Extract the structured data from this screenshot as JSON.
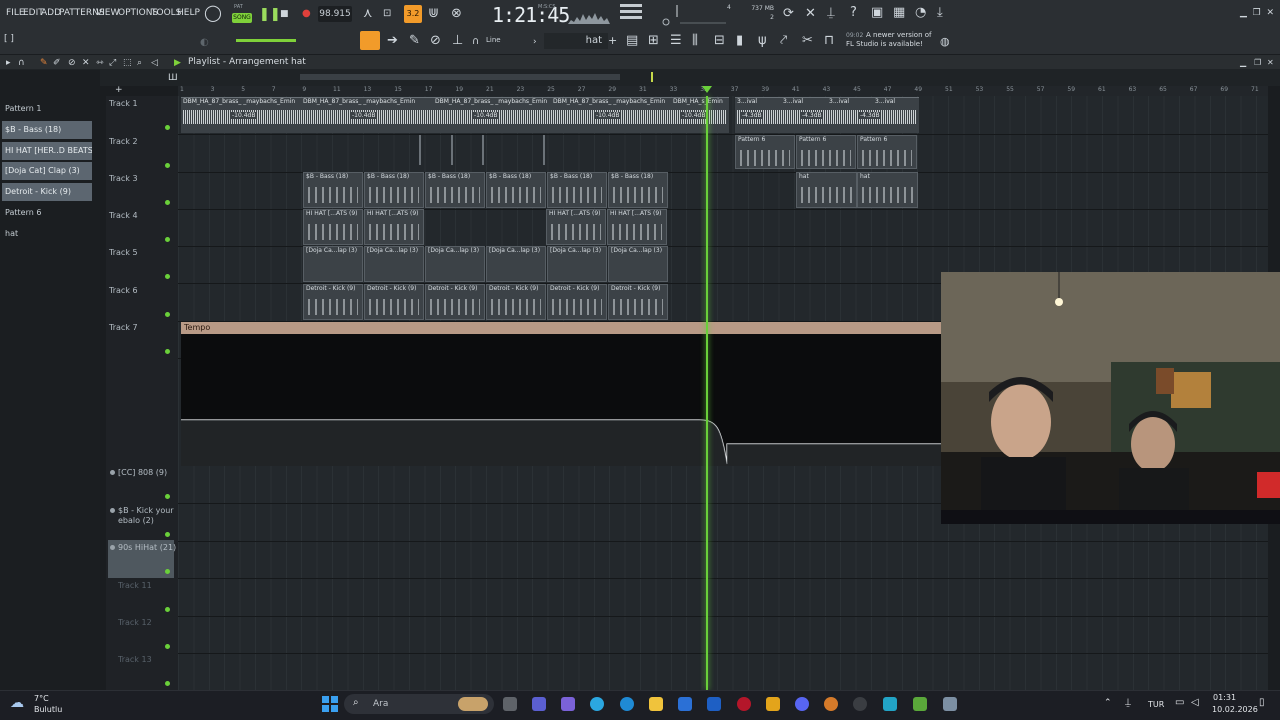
{
  "menu": {
    "file": "FILE",
    "edit": "EDIT",
    "add": "ADD",
    "patterns": "PATTERNS",
    "view": "VIEW",
    "options": "OPTIONS",
    "tools": "TOOLS",
    "help": "HELP"
  },
  "transport": {
    "pat_label": "PAT",
    "song_label": "SONG",
    "tempo": "98.915",
    "time": "1:21:45",
    "time_unit": "M:S:CS",
    "snap": "3.2",
    "memory": "737 MB",
    "cpu": "2",
    "voices": "4"
  },
  "toolbar2": {
    "line_label": "Line",
    "pattern_name": "hat",
    "update_time": "09:02",
    "update_msg": "A newer version of FL Studio is available!"
  },
  "playlist": {
    "title": "Playlist - Arrangement",
    "separator": "›",
    "pattern": "hat"
  },
  "picker": [
    {
      "label": "Pattern 1",
      "selected": false
    },
    {
      "label": "$B - Bass (18)",
      "selected": true
    },
    {
      "label": "HI HAT [HER..D BEATS (9)",
      "selected": true
    },
    {
      "label": "[Doja Cat] Clap (3)",
      "selected": true
    },
    {
      "label": "Detroit - Kick (9)",
      "selected": true
    },
    {
      "label": "Pattern 6",
      "selected": false
    },
    {
      "label": "hat",
      "selected": false
    }
  ],
  "tracks": [
    {
      "name": "Track 1"
    },
    {
      "name": "Track 2"
    },
    {
      "name": "Track 3"
    },
    {
      "name": "Track 4"
    },
    {
      "name": "Track 5"
    },
    {
      "name": "Track 6"
    },
    {
      "name": "Track 7"
    },
    {
      "name": "[CC] 808 (9)"
    },
    {
      "name": "$B - Kick your ebalo (2)"
    },
    {
      "name": "90s HiHat (21)"
    },
    {
      "name": "Track 11"
    },
    {
      "name": "Track 12"
    },
    {
      "name": "Track 13"
    }
  ],
  "ruler": [
    "1",
    "3",
    "5",
    "7",
    "9",
    "11",
    "13",
    "15",
    "17",
    "19",
    "21",
    "23",
    "25",
    "27",
    "29",
    "31",
    "33",
    "35",
    "37",
    "39",
    "41",
    "43",
    "45",
    "47",
    "49",
    "51",
    "53",
    "55",
    "57",
    "59",
    "61",
    "63",
    "65",
    "67",
    "69",
    "71"
  ],
  "clips": {
    "audio_label": "DBM_HA_87_brass_ _maybachs_Emin",
    "audio_db": "-10.4dB",
    "audio_label2": "DBM_HA_s_Emin",
    "audio_right": "3...ival",
    "audio_right_db": "-4.3dB",
    "pattern6": "Pattern 6",
    "bass": "$B - Bass (18)",
    "hihat": "HI HAT [...ATS (9)",
    "clap": "[Doja Ca...lap (3)",
    "kick": "Detroit - Kick (9)",
    "hat": "hat",
    "tempo": "Tempo"
  },
  "taskbar": {
    "temp": "7°C",
    "weather": "Bulutlu",
    "search": "Ara",
    "lang": "TUR",
    "time": "01:31",
    "date": "10.02.2026"
  }
}
